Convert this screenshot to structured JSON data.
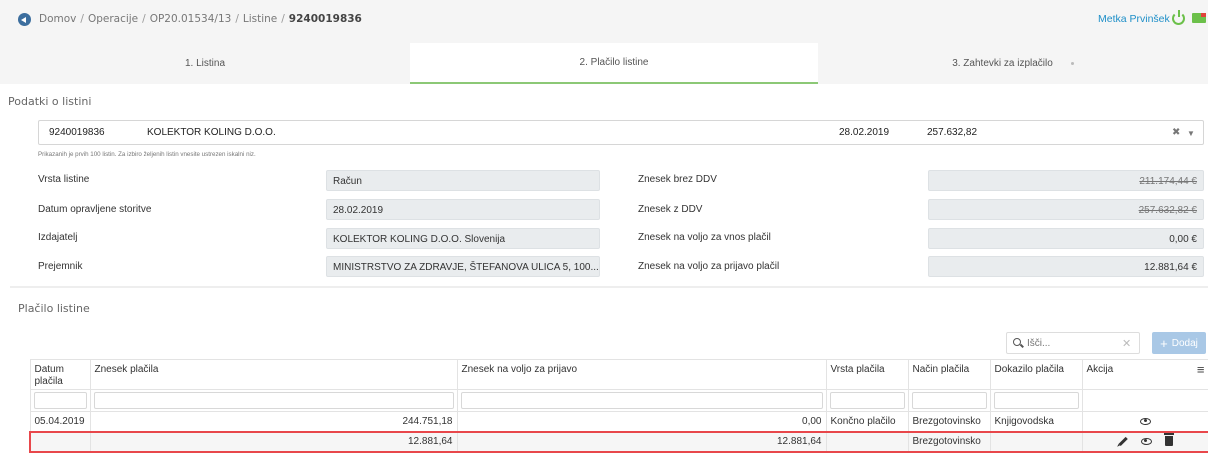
{
  "breadcrumb": [
    "Domov",
    "Operacije",
    "OP20.01534/13",
    "Listine",
    "9240019836"
  ],
  "user": {
    "name": "Metka Prvinšek"
  },
  "steps": [
    {
      "label": "1. Listina",
      "active": false
    },
    {
      "label": "2. Plačilo listine",
      "active": true
    },
    {
      "label": "3. Zahtevki za izplačilo",
      "active": false
    }
  ],
  "document_section": {
    "title": "Podatki o listini",
    "selected": {
      "number": "9240019836",
      "company": "KOLEKTOR KOLING D.O.O.",
      "date": "28.02.2019",
      "amount": "257.632,82"
    },
    "hint": "Prikazanih je prvih 100 listin. Za izbiro željenih listin vnesite ustrezen iskalni niz.",
    "fields_left": [
      {
        "label": "Vrsta listine",
        "value": "Račun"
      },
      {
        "label": "Datum opravljene storitve",
        "value": "28.02.2019"
      },
      {
        "label": "Izdajatelj",
        "value": "KOLEKTOR KOLING D.O.O. Slovenija"
      },
      {
        "label": "Prejemnik",
        "value": "MINISTRSTVO ZA ZDRAVJE, ŠTEFANOVA ULICA 5, 100..."
      }
    ],
    "fields_right": [
      {
        "label": "Znesek brez DDV",
        "value": "211.174,44 €"
      },
      {
        "label": "Znesek z DDV",
        "value": "257.632,82 €"
      },
      {
        "label": "Znesek na voljo za vnos plačil",
        "value": "0,00 €"
      },
      {
        "label": "Znesek na voljo za prijavo plačil",
        "value": "12.881,64 €"
      }
    ]
  },
  "payment_section": {
    "title": "Plačilo listine",
    "search_placeholder": "Išči...",
    "add_label": "Dodaj",
    "columns": [
      "Datum plačila",
      "Znesek plačila",
      "Znesek na voljo za prijavo",
      "Vrsta plačila",
      "Način plačila",
      "Dokazilo plačila",
      "Akcija"
    ],
    "rows": [
      {
        "date": "05.04.2019",
        "amount": "244.751,18",
        "available": "0,00",
        "type": "Končno plačilo",
        "method": "Brezgotovinsko",
        "proof": "Knjigovodska",
        "selected": false
      },
      {
        "date": "",
        "amount": "12.881,64",
        "available": "12.881,64",
        "type": "",
        "method": "Brezgotovinsko",
        "proof": "",
        "selected": true
      }
    ]
  }
}
